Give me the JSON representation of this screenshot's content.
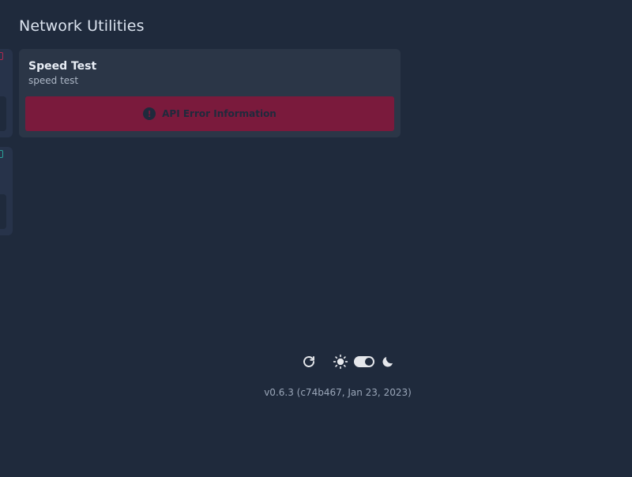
{
  "section": {
    "title": "Network Utilities"
  },
  "card": {
    "title": "Speed Test",
    "subtitle": "speed test",
    "error_label": "API Error Information",
    "error_icon_glyph": "!"
  },
  "footer": {
    "version": "v0.6.3 (c74b467, Jan 23, 2023)"
  },
  "icons": {
    "refresh": "refresh-icon",
    "light_mode": "sun-icon",
    "theme_toggle": "toggle-switch",
    "dark_mode": "moon-icon"
  },
  "colors": {
    "background": "#1f2a3c",
    "card": "#2b3647",
    "error": "#7a1a3c",
    "text": "#e5e7eb"
  }
}
